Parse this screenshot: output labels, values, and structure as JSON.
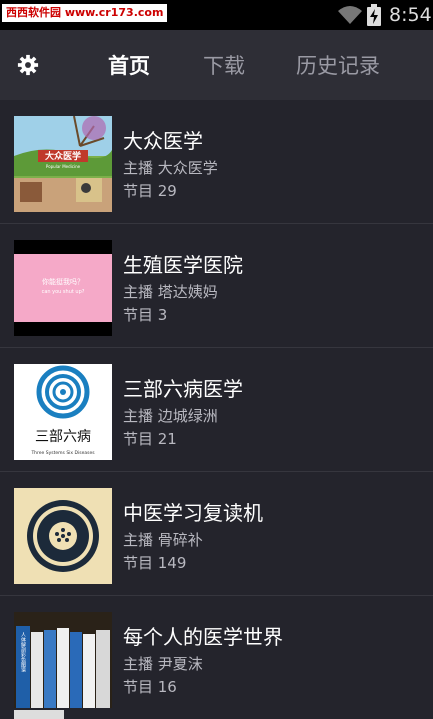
{
  "status_bar": {
    "watermark": "西西软件园 www.cr173.com",
    "time": "8:54"
  },
  "topbar": {
    "tabs": [
      {
        "label": "首页",
        "active": true
      },
      {
        "label": "下载",
        "active": false
      },
      {
        "label": "历史记录",
        "active": false
      }
    ]
  },
  "programs": [
    {
      "title": "大众医学",
      "host": "主播 大众医学",
      "count": "节目 29",
      "cover_text": "大众医学",
      "cover_sub": "Popular Medicine"
    },
    {
      "title": "生殖医学医院",
      "host": "主播 塔达姨妈",
      "count": "节目 3",
      "cover_text": "你能挺我吗？",
      "cover_sub": "can you shut up?"
    },
    {
      "title": "三部六病医学",
      "host": "主播 边城绿洲",
      "count": "节目 21",
      "cover_text": "三部六病",
      "cover_sub": "Three Systems Six Diseases"
    },
    {
      "title": "中医学习复读机",
      "host": "主播 骨碎补",
      "count": "节目 149"
    },
    {
      "title": "每个人的医学世界",
      "host": "主播 尹夏沫",
      "count": "节目 16",
      "cover_text": "人体解剖彩色图谱"
    }
  ],
  "colors": {
    "background": "#24242c",
    "topbar": "#2e2e36",
    "tab_active": "#ffffff",
    "tab_inactive": "#9a9aa4"
  }
}
